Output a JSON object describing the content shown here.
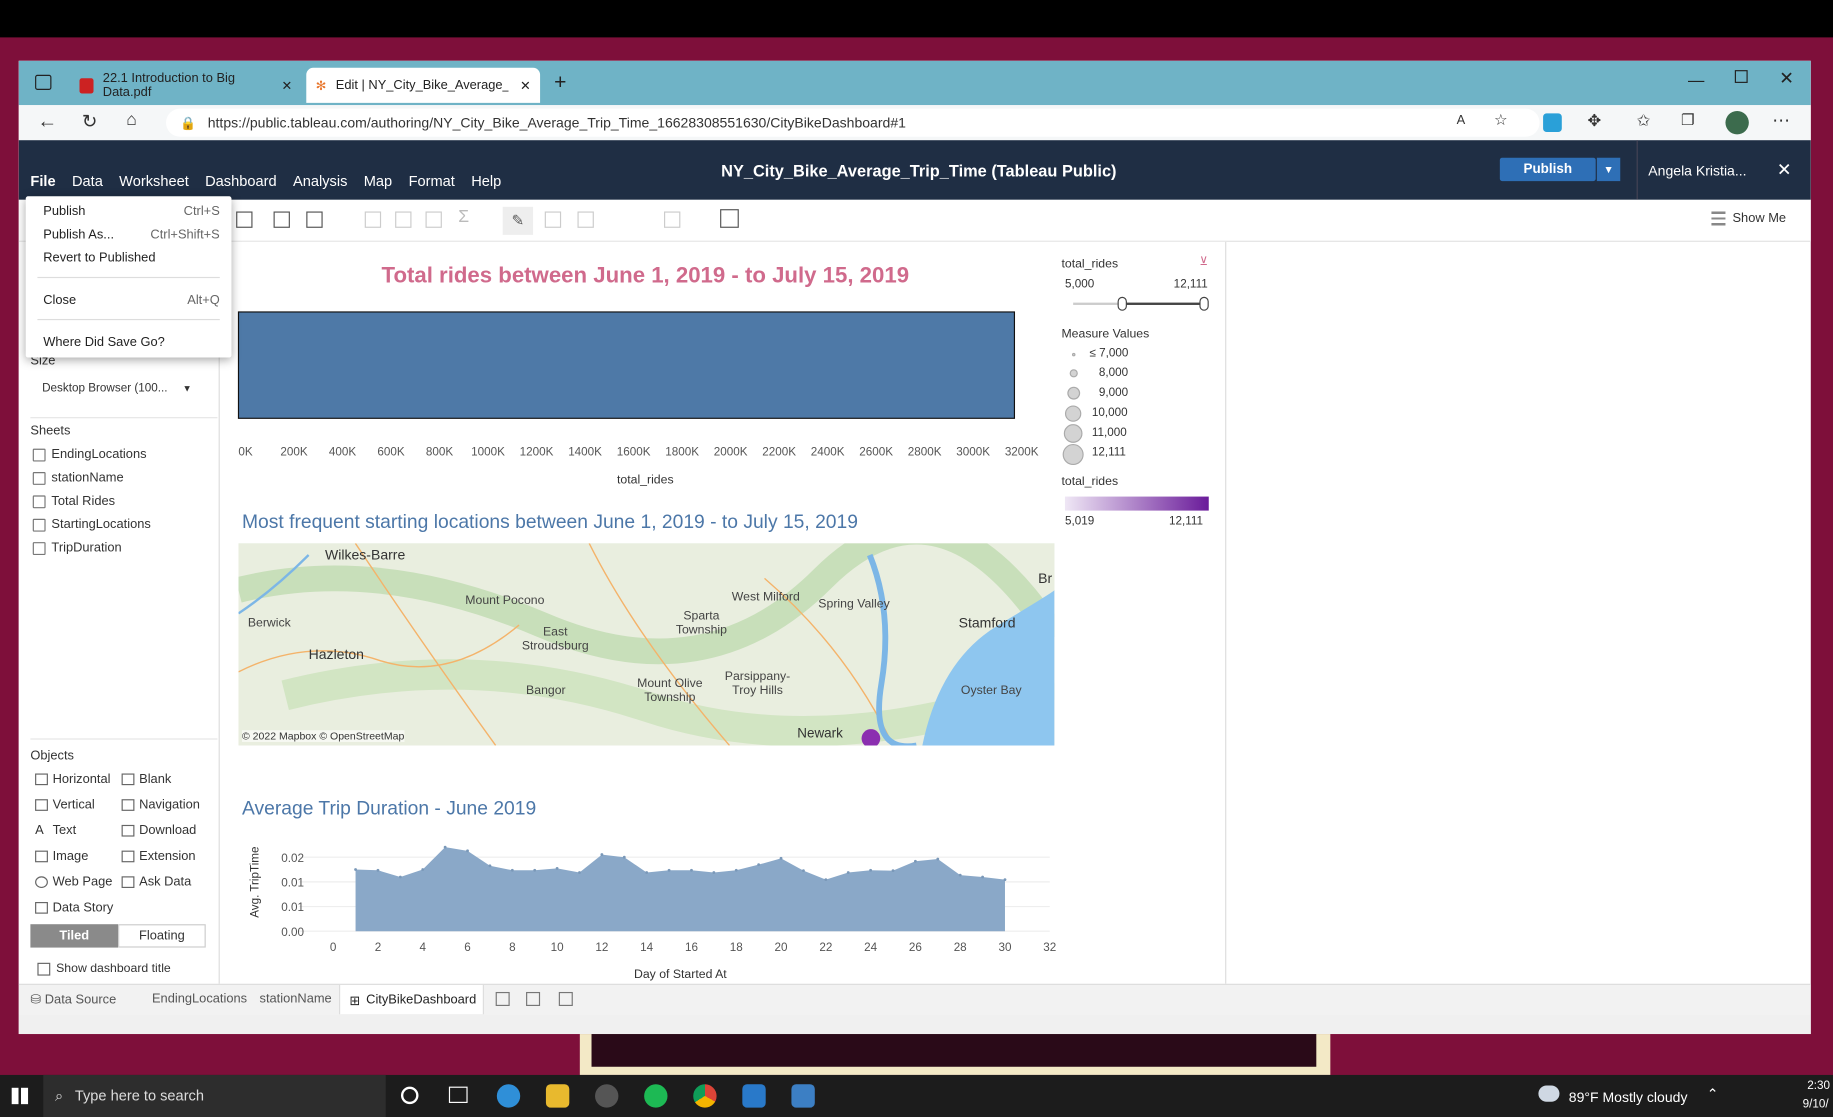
{
  "browser": {
    "tabs": [
      {
        "label": "22.1 Introduction to Big Data.pdf"
      },
      {
        "label": "Edit | NY_City_Bike_Average_Trip"
      }
    ],
    "url": "https://public.tableau.com/authoring/NY_City_Bike_Average_Trip_Time_16628308551630/CityBikeDashboard#1"
  },
  "app": {
    "title": "NY_City_Bike_Average_Trip_Time (Tableau Public)",
    "publish_label": "Publish",
    "user": "Angela Kristia...",
    "menu": [
      "File",
      "Data",
      "Worksheet",
      "Dashboard",
      "Analysis",
      "Map",
      "Format",
      "Help"
    ],
    "show_me": "Show Me"
  },
  "file_menu": [
    {
      "label": "Publish",
      "shortcut": "Ctrl+S"
    },
    {
      "label": "Publish As...",
      "shortcut": "Ctrl+Shift+S"
    },
    {
      "label": "Revert to Published",
      "shortcut": ""
    },
    {
      "label": "Close",
      "shortcut": "Alt+Q"
    },
    {
      "label": "Where Did Save Go?",
      "shortcut": ""
    }
  ],
  "sidebar": {
    "size_label": "Size",
    "size_value": "Desktop Browser (100...",
    "sheets_header": "Sheets",
    "sheets": [
      "EndingLocations",
      "stationName",
      "Total Rides",
      "StartingLocations",
      "TripDuration"
    ],
    "objects_header": "Objects",
    "objects": [
      "Horizontal",
      "Blank",
      "Vertical",
      "Navigation",
      "Text",
      "Download",
      "Image",
      "Extension",
      "Web Page",
      "Ask Data",
      "Data Story"
    ],
    "tiled": "Tiled",
    "floating": "Floating",
    "show_title": "Show dashboard title"
  },
  "bar_chart": {
    "title": "Total rides between June 1, 2019 - to July 15, 2019",
    "xlabel": "total_rides",
    "ticks": [
      "0K",
      "200K",
      "400K",
      "600K",
      "800K",
      "1000K",
      "1200K",
      "1400K",
      "1600K",
      "1800K",
      "2000K",
      "2200K",
      "2400K",
      "2600K",
      "2800K",
      "3000K",
      "3200K"
    ],
    "value_k": 3170
  },
  "map": {
    "title": "Most frequent starting locations between June 1, 2019 - to July 15, 2019",
    "places": [
      "Wilkes-Barre",
      "Mount Pocono",
      "East Stroudsburg",
      "Berwick",
      "Hazleton",
      "Bangor",
      "Sparta Township",
      "West Milford",
      "Spring Valley",
      "Stamford",
      "Mount Olive Township",
      "Parsippany-Troy Hills",
      "Oyster Bay",
      "Newark",
      "Br"
    ],
    "attribution": "© 2022 Mapbox  © OpenStreetMap"
  },
  "chart_data": {
    "type": "area",
    "title": "Average Trip Duration - June 2019",
    "xlabel": "Day of Started At",
    "ylabel": "Avg. TripTime",
    "x": [
      1,
      2,
      3,
      4,
      5,
      6,
      7,
      8,
      9,
      10,
      11,
      12,
      13,
      14,
      15,
      16,
      17,
      18,
      19,
      20,
      21,
      22,
      23,
      24,
      25,
      26,
      27,
      28,
      29,
      30
    ],
    "values": [
      0.0165,
      0.0163,
      0.0145,
      0.0165,
      0.0225,
      0.0215,
      0.0175,
      0.0163,
      0.0163,
      0.0168,
      0.0157,
      0.0205,
      0.0198,
      0.0157,
      0.0163,
      0.0163,
      0.0157,
      0.0163,
      0.0178,
      0.0195,
      0.0162,
      0.0138,
      0.0157,
      0.0163,
      0.0162,
      0.0187,
      0.0193,
      0.015,
      0.0145,
      0.0138
    ],
    "xticks": [
      "0",
      "2",
      "4",
      "6",
      "8",
      "10",
      "12",
      "14",
      "16",
      "18",
      "20",
      "22",
      "24",
      "26",
      "28",
      "30",
      "32"
    ],
    "yticks": [
      "0.02",
      "0.01",
      "0.01",
      "0.00"
    ],
    "xlim": [
      0,
      32
    ],
    "ylim": [
      0,
      0.025
    ],
    "color": "#8aa8c8"
  },
  "legends": {
    "filter_title": "total_rides",
    "filter_min": "5,000",
    "filter_max": "12,111",
    "measure_title": "Measure Values",
    "measure_items": [
      "≤ 7,000",
      "8,000",
      "9,000",
      "10,000",
      "11,000",
      "12,111"
    ],
    "color_title": "total_rides",
    "color_min": "5,019",
    "color_max": "12,111"
  },
  "bottom_tabs": [
    "Data Source",
    "EndingLocations",
    "stationName",
    "CityBikeDashboard"
  ],
  "taskbar": {
    "search": "Type here to search",
    "weather": "89°F  Mostly cloudy",
    "time": "2:30",
    "date": "9/10/"
  }
}
